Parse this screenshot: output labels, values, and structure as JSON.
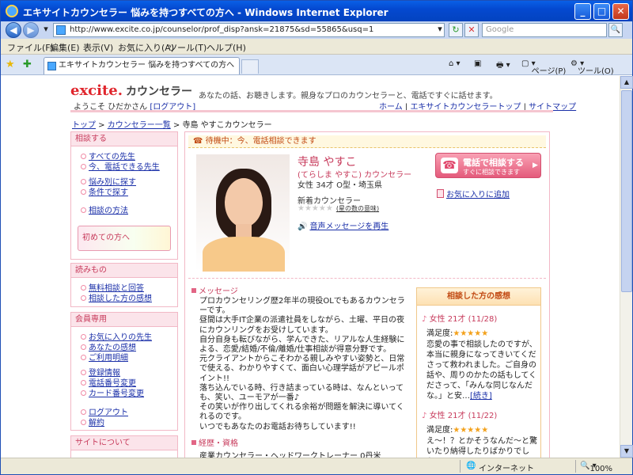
{
  "window": {
    "title": "エキサイトカウンセラー 悩みを持つすべての方へ - Windows Internet Explorer"
  },
  "browser": {
    "url": "http://www.excite.co.jp/counselor/prof_disp?ansk=21875&sd=55865&usq=1",
    "search_placeholder": "Google",
    "menu": [
      "ファイル(F)",
      "編集(E)",
      "表示(V)",
      "お気に入り(A)",
      "ツール(T)",
      "ヘルプ(H)"
    ],
    "tab_title": "エキサイトカウンセラー 悩みを持つすべての方へ",
    "toolbar_page": "ページ(P)",
    "toolbar_tools": "ツール(O)",
    "status_zone": "インターネット",
    "zoom": "100%"
  },
  "site": {
    "logo_excite": "excite.",
    "logo_counselor": "カウンセラー",
    "tagline": "あなたの話、お聴きします。親身なプロのカウンセラーと、電話ですぐに話せます。",
    "welcome_prefix": "ようこそ ひだかさん ",
    "logout": "[ログアウト]",
    "top_links": [
      "ホーム",
      "エキサイトカウンセラートップ",
      "サイトマップ"
    ],
    "breadcrumb": [
      "トップ",
      "カウンセラー一覧",
      "寺島 やすこカウンセラー"
    ]
  },
  "sidebar": {
    "section1_title": "相談する",
    "section1_items": [
      "すべての先生",
      "今、電話できる先生",
      "悩み別に探す",
      "条件で探す",
      "相談の方法"
    ],
    "first_time_banner": "初めての方へ",
    "section2_title": "読みもの",
    "section2_items": [
      "無料相談と回答",
      "相談した方の感想"
    ],
    "section3_title": "会員専用",
    "section3_items": [
      "お気に入りの先生",
      "あなたの感想",
      "ご利用明細",
      "登録情報",
      "電話番号変更",
      "カード番号変更",
      "ログアウト",
      "解約"
    ],
    "section4_title": "サイトについて"
  },
  "profile": {
    "status": "待機中：今、電話相談できます",
    "name": "寺島 やすこ",
    "kana": "(てらしま やすこ) カウンセラー",
    "info": "女性 34才 O型・埼玉県",
    "rank": "新着カウンセラー",
    "stars": "★★★★★",
    "stars_note": "星の数の意味",
    "voice_link": "音声メッセージを再生",
    "call_button": "電話で相談する",
    "call_sub": "すぐに相談できます",
    "favorite_link": "お気に入りに追加",
    "message_title": "メッセージ",
    "message": [
      "プロカウンセリング歴2年半の現役OLでもあるカウンセラーです。",
      "昼間は大手IT企業の派遣社員をしながら、土曜、平日の夜にカウンリングをお受けしています。",
      "自分自身も転びながら、学んできた、リアルな人生経験による、恋愛/結婚/不倫/離婚/仕事相談が得意分野です。",
      "元クライアントからこそわかる親しみやすい姿勢と、日常で使える、わかりやすくて、面白い心理学話がアピールポイント!!",
      "落ち込んでいる時、行き詰まっている時は、なんといっても、笑い、ユーモアが一番♪",
      "その笑いが作り出してくれる余裕が問題を解決に導いてくれるのです。",
      "いつでもあなたのお電話お待ちしています!!"
    ],
    "experience_title": "経歴・資格",
    "experience_line": "産業カウンセラー・ヘッドワークトレーナー 0丹米"
  },
  "reviews": {
    "title": "相談した方の感想",
    "items": [
      {
        "who": "女性 21才",
        "date": "(11/28)",
        "label": "満足度:",
        "stars": "★★★★★",
        "text": "恋愛の事で相談したのですが、本当に親身になってきいてくださって救われました。ご自身の話や、周りのかたの話もしてくださって、「みんな同じなんだな。」と安…",
        "more": "[続き]"
      },
      {
        "who": "女性 21才",
        "date": "(11/22)",
        "label": "満足度:",
        "stars": "★★★★★",
        "text": "え～！？とかそうなんだ～と驚いたり納得したりばかりでした。",
        "more": ""
      }
    ]
  },
  "colors": {
    "accent_pink": "#c73a5b",
    "link_blue": "#1a2fa8",
    "star_orange": "#f3a11b",
    "status_orange": "#c24b14"
  }
}
